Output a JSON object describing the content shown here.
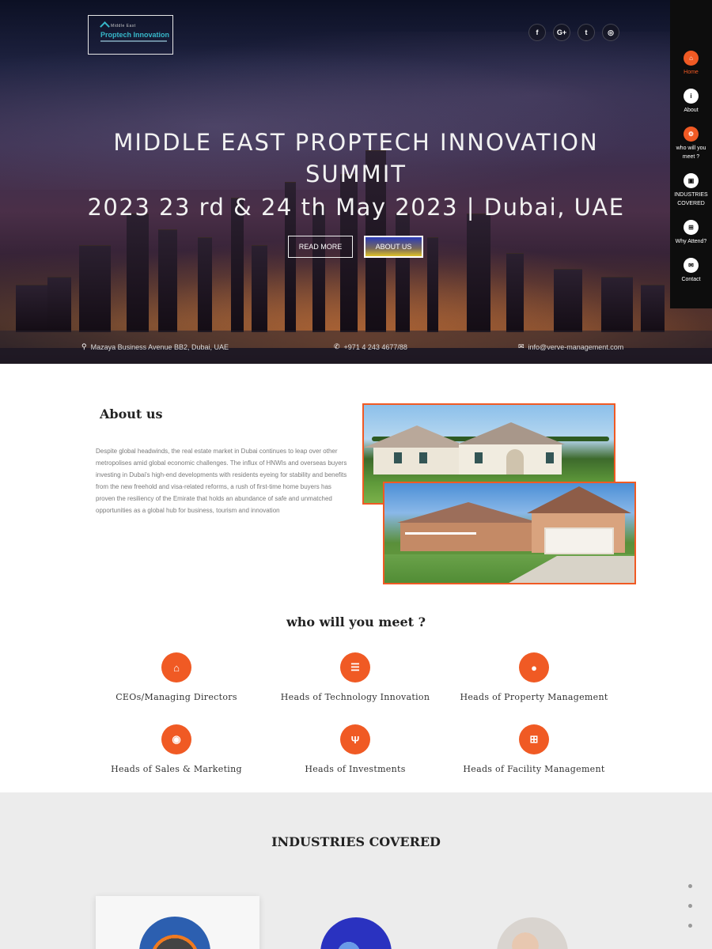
{
  "logo": {
    "top_text": "Middle East",
    "main_text": "Proptech Innovation"
  },
  "social": [
    {
      "icon": "facebook-icon",
      "glyph": "f"
    },
    {
      "icon": "google-plus-icon",
      "glyph": "G+"
    },
    {
      "icon": "twitter-icon",
      "glyph": "t"
    },
    {
      "icon": "dribbble-icon",
      "glyph": "◎"
    }
  ],
  "hero": {
    "title_line1": "MIDDLE EAST PROPTECH INNOVATION",
    "title_line2": "SUMMIT",
    "title_line3": "2023 23 rd & 24 th May 2023 | Dubai, UAE",
    "read_more": "READ MORE",
    "about_us": "ABOUT US"
  },
  "contact": {
    "address": "Mazaya Business Avenue BB2, Dubai, UAE",
    "phone": "+971 4 243 4677/88",
    "email": "info@verve-management.com"
  },
  "sidenav": [
    {
      "label": "Home",
      "icon": "home-icon",
      "glyph": "⌂",
      "active": true
    },
    {
      "label": "About",
      "icon": "info-icon",
      "glyph": "i",
      "active": false
    },
    {
      "label": "who will you meet ?",
      "icon": "gears-icon",
      "glyph": "⚙",
      "active": false
    },
    {
      "label": "INDUSTRIES COVERED",
      "icon": "image-icon",
      "glyph": "▣",
      "active": false
    },
    {
      "label": "Why Attend?",
      "icon": "grid-icon",
      "glyph": "⊞",
      "active": false
    },
    {
      "label": "Contact",
      "icon": "envelope-icon",
      "glyph": "✉",
      "active": false
    }
  ],
  "about": {
    "heading": "About us",
    "text": "Despite global headwinds, the real estate market in Dubai continues to leap over other metropolises amid global economic challenges. The influx of HNWIs and overseas buyers investing in Dubai's high-end developments with residents eyeing for stability and benefits from the new freehold and visa-related reforms, a rush of first-time home buyers has proven the resiliency of the Emirate that holds an abundance of safe and unmatched opportunities as a global hub for business, tourism and innovation"
  },
  "meet": {
    "heading": "who will you meet ?",
    "roles": [
      {
        "label": "CEOs/Managing Directors",
        "icon": "home-icon",
        "glyph": "⌂"
      },
      {
        "label": "Heads of Technology Innovation",
        "icon": "list-icon",
        "glyph": "☰"
      },
      {
        "label": "Heads of Property Management",
        "icon": "lightbulb-icon",
        "glyph": "●"
      },
      {
        "label": "Heads of Sales & Marketing",
        "icon": "globe-icon",
        "glyph": "◉"
      },
      {
        "label": "Heads of Investments",
        "icon": "cutlery-icon",
        "glyph": "Ψ"
      },
      {
        "label": "Heads of Facility Management",
        "icon": "grid-icon",
        "glyph": "⊞"
      }
    ]
  },
  "industries": {
    "heading": "INDUSTRIES COVERED"
  },
  "colors": {
    "accent": "#f05a24",
    "dark": "#0d0d0d",
    "section_bg": "#ececec"
  }
}
